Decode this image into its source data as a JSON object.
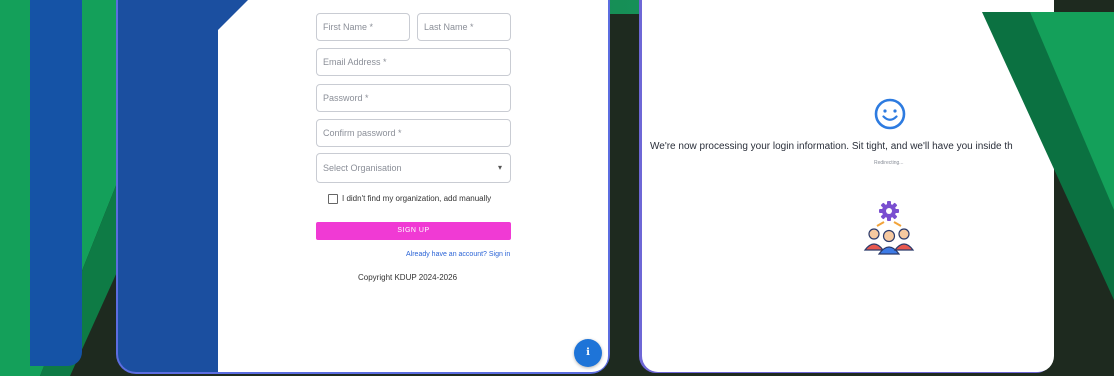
{
  "signup": {
    "first_name_placeholder": "First Name *",
    "last_name_placeholder": "Last Name *",
    "email_placeholder": "Email Address *",
    "password_placeholder": "Password *",
    "confirm_password_placeholder": "Confirm password *",
    "organisation_select_value": "Select Organisation",
    "manual_org_checkbox_label": "I didn't find my organization, add manually",
    "submit_label": "SIGN UP",
    "signin_link": "Already have an account? Sign in",
    "copyright": "Copyright KDUP 2024-2026",
    "fab_icon": "info-icon"
  },
  "processing": {
    "message": "We're now processing your login information. Sit tight, and we'll have you inside th",
    "hint": "Redirecting...",
    "status_icon": "smiley-icon",
    "illustration_icon": "team-settings-icon"
  },
  "colors": {
    "accent_green": "#14a05a",
    "signup_button": "#f03ad4",
    "link_blue": "#2b64d6",
    "fab_blue": "#1e74d8",
    "smiley_blue": "#2d7be0"
  }
}
